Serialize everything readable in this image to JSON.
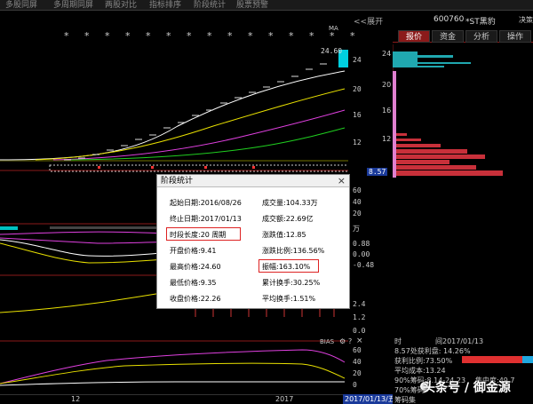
{
  "toolbar": {
    "items": [
      "多股同屏",
      "多周期同屏",
      "两股对比",
      "指标排序",
      "阶段统计",
      "股票预警"
    ]
  },
  "expand_label": "<<展开",
  "main_chart": {
    "ma_label": "MA",
    "price_tag": "24.60",
    "stars": "* * * * * * * * * * * * * * *"
  },
  "axis": {
    "volume_unit": "万",
    "ticks_main": [
      "24",
      "20",
      "16",
      "12",
      "8.57"
    ],
    "ticks_vol": [
      "60",
      "40",
      "20"
    ],
    "ticks_ind": [
      "0.88",
      "0.00",
      "-0.48"
    ],
    "ticks_macd": [
      "2.4",
      "1.2",
      "0.0"
    ],
    "ticks_bias": [
      "60",
      "40",
      "20",
      "0"
    ],
    "bottom_left": "12",
    "bottom_mid": "2017",
    "date_box": "2017/01/13/五"
  },
  "stock": {
    "code": "600760",
    "name": "*ST黑豹",
    "rt_btn": "决策"
  },
  "right_tabs": [
    "报价",
    "资金",
    "分析",
    "操作"
  ],
  "right_info": {
    "time_label": "时",
    "time_value": "间2017/01/13",
    "profit_label": "8.57处获利盘: 14.26%",
    "profit_ratio": "获利比例:73.50%",
    "avg_cost": "平均成本:13.24",
    "chip_90": "90%筹码:8.14-24.23",
    "chip_90_conc": "集中度:49.7",
    "chip_70": "70%筹码",
    "chip_70b": "筹码集"
  },
  "dialog": {
    "title": "阶段统计",
    "start_label": "起始日期:2016/08/26",
    "end_label": "终止日期:2017/01/13",
    "duration_label": "时段长度:20 周期",
    "open_label": "开盘价格:9.41",
    "high_label": "最高价格:24.60",
    "low_label": "最低价格:9.35",
    "close_label": "收盘价格:22.26",
    "volume_label": "成交量:104.33万",
    "amount_label": "成交额:22.69亿",
    "change_label": "涨跌值:12.85",
    "change_pct_label": "涨跌比例:136.56%",
    "amplitude_label": "振幅:163.10%",
    "turnover_label": "累计换手:30.25%",
    "avg_turnover_label": "平均换手:1.51%"
  },
  "indicator": {
    "bias_label": "BIAS"
  },
  "watermark": "头条号 / 御金源",
  "colors": {
    "ma1": "#ffffff",
    "ma2": "#e8e000",
    "ma3": "#e040e0",
    "ma4": "#20d020",
    "price_up": "#ff3333",
    "candle_last": "#00d0e0",
    "chip_red": "#c8303a",
    "chip_cyan": "#20a8b0",
    "highlight": "#dd2222"
  }
}
